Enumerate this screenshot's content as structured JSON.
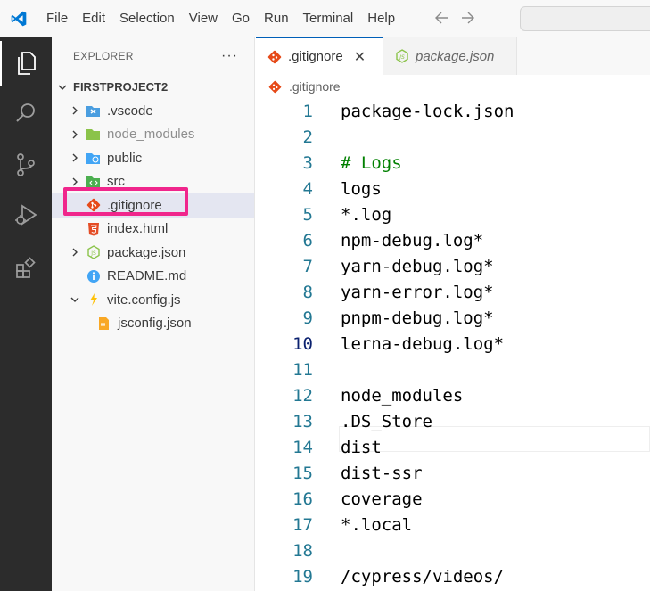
{
  "menu": [
    "File",
    "Edit",
    "Selection",
    "View",
    "Go",
    "Run",
    "Terminal",
    "Help"
  ],
  "explorer": {
    "title": "EXPLORER",
    "more": "···",
    "project": "FIRSTPROJECT2",
    "items": [
      {
        "label": ".vscode",
        "chevron": "right",
        "icon": "vscode-folder-icon",
        "dim": false
      },
      {
        "label": "node_modules",
        "chevron": "right",
        "icon": "node-folder-icon",
        "dim": true
      },
      {
        "label": "public",
        "chevron": "right",
        "icon": "public-folder-icon",
        "dim": false
      },
      {
        "label": "src",
        "chevron": "right",
        "icon": "src-folder-icon",
        "dim": false
      },
      {
        "label": ".gitignore",
        "chevron": "",
        "icon": "git-icon",
        "dim": false,
        "selected": true
      },
      {
        "label": "index.html",
        "chevron": "",
        "icon": "html5-icon",
        "dim": false
      },
      {
        "label": "package.json",
        "chevron": "right",
        "icon": "nodejs-icon",
        "dim": false
      },
      {
        "label": "README.md",
        "chevron": "",
        "icon": "info-icon",
        "dim": false
      },
      {
        "label": "vite.config.js",
        "chevron": "down",
        "icon": "vite-icon",
        "dim": false
      },
      {
        "label": "jsconfig.json",
        "chevron": "",
        "icon": "json-config-icon",
        "dim": false,
        "nested": true
      }
    ]
  },
  "tabs": [
    {
      "label": ".gitignore",
      "active": true,
      "close": "✕"
    },
    {
      "label": "package.json",
      "active": false
    }
  ],
  "breadcrumb": ".gitignore",
  "editor": {
    "current_line": 10,
    "lines": [
      {
        "n": "1",
        "text": "package-lock.json"
      },
      {
        "n": "2",
        "text": ""
      },
      {
        "n": "3",
        "text": "# Logs",
        "comment": true
      },
      {
        "n": "4",
        "text": "logs"
      },
      {
        "n": "5",
        "text": "*.log"
      },
      {
        "n": "6",
        "text": "npm-debug.log*"
      },
      {
        "n": "7",
        "text": "yarn-debug.log*"
      },
      {
        "n": "8",
        "text": "yarn-error.log*"
      },
      {
        "n": "9",
        "text": "pnpm-debug.log*"
      },
      {
        "n": "10",
        "text": "lerna-debug.log*"
      },
      {
        "n": "11",
        "text": ""
      },
      {
        "n": "12",
        "text": "node_modules"
      },
      {
        "n": "13",
        "text": ".DS_Store"
      },
      {
        "n": "14",
        "text": "dist"
      },
      {
        "n": "15",
        "text": "dist-ssr"
      },
      {
        "n": "16",
        "text": "coverage"
      },
      {
        "n": "17",
        "text": "*.local"
      },
      {
        "n": "18",
        "text": ""
      },
      {
        "n": "19",
        "text": "/cypress/videos/"
      }
    ]
  },
  "colors": {
    "accent": "#005fb8",
    "highlight_box": "#f0268c",
    "line_number": "#237893",
    "comment": "#008000",
    "activity_bar": "#2c2c2c"
  }
}
